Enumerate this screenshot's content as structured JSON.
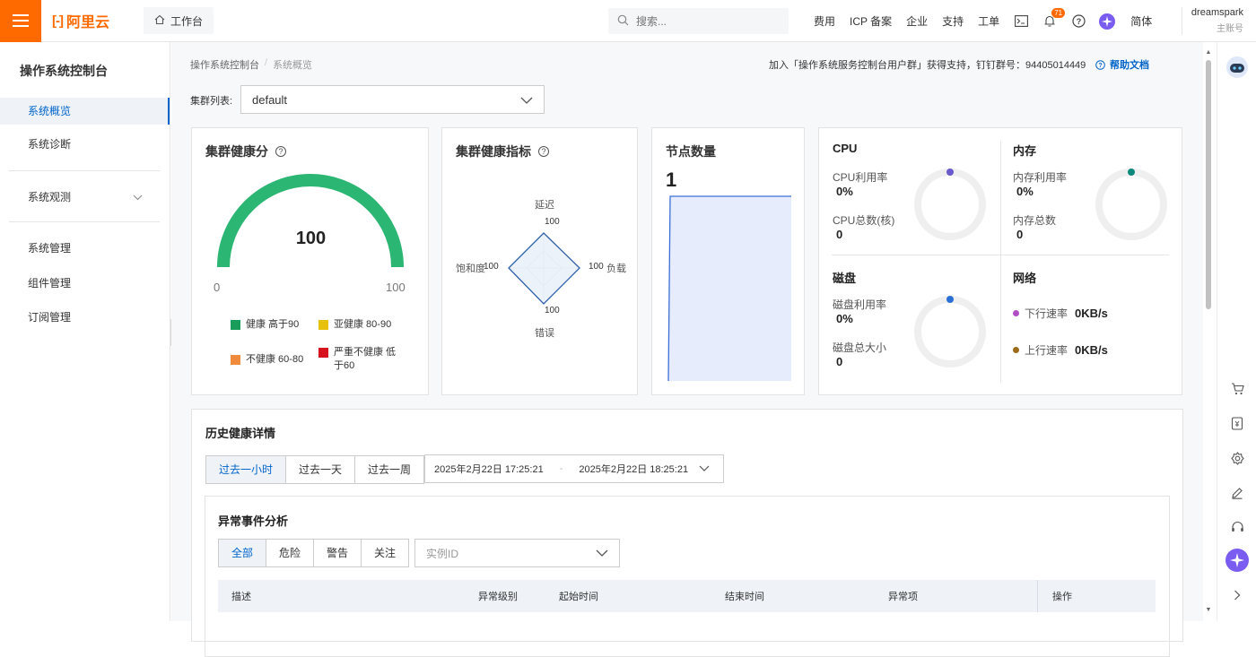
{
  "topbar": {
    "brand": "阿里云",
    "workbench": "工作台",
    "search_placeholder": "搜索...",
    "nav": [
      "费用",
      "ICP 备案",
      "企业",
      "支持",
      "工单"
    ],
    "notification_count": "71",
    "language": "简体",
    "account_name": "dreamspark",
    "account_role": "主账号"
  },
  "sidebar": {
    "title": "操作系统控制台",
    "items": [
      "系统概览",
      "系统诊断",
      "系统观测",
      "系统管理",
      "组件管理",
      "订阅管理"
    ]
  },
  "breadcrumb": [
    "操作系统控制台",
    "系统概览"
  ],
  "join_text": "加入「操作系统服务控制台用户群」获得支持，钉钉群号：94405014449",
  "help_text": "帮助文档",
  "cluster": {
    "label": "集群列表:",
    "value": "default"
  },
  "health_score": {
    "title": "集群健康分",
    "value": "100",
    "min": "0",
    "max": "100",
    "legend": [
      {
        "label": "健康 高于90",
        "color": "#1a9c5b"
      },
      {
        "label": "亚健康 80-90",
        "color": "#e8c10c"
      },
      {
        "label": "不健康 60-80",
        "color": "#f08a3c"
      },
      {
        "label": "严重不健康 低于60",
        "color": "#d7121f"
      }
    ],
    "gauge_color": "#2bb673",
    "gauge_fraction": 1.0
  },
  "health_metrics": {
    "title": "集群健康指标",
    "axes": {
      "top": "延迟",
      "right": "负载",
      "bottom": "错误",
      "left": "饱和度"
    },
    "values": {
      "top": "100",
      "right": "100",
      "bottom": "100",
      "left": "100"
    }
  },
  "nodes": {
    "title": "节点数量",
    "value": "1"
  },
  "resources": {
    "cpu": {
      "title": "CPU",
      "usage_label": "CPU利用率",
      "usage": "0%",
      "total_label": "CPU总数(核)",
      "total": "0",
      "dot_color": "#6a5acd"
    },
    "memory": {
      "title": "内存",
      "usage_label": "内存利用率",
      "usage": "0%",
      "total_label": "内存总数",
      "total": "0",
      "dot_color": "#0e8a7d"
    },
    "disk": {
      "title": "磁盘",
      "usage_label": "磁盘利用率",
      "usage": "0%",
      "total_label": "磁盘总大小",
      "total": "0",
      "dot_color": "#2a6fd6"
    },
    "network": {
      "title": "网络",
      "down_label": "下行速率",
      "down": "0KB/s",
      "down_color": "#b04fc4",
      "up_label": "上行速率",
      "up": "0KB/s",
      "up_color": "#9c6a1a"
    }
  },
  "history": {
    "title": "历史健康详情",
    "ranges": [
      "过去一小时",
      "过去一天",
      "过去一周"
    ],
    "start": "2025年2月22日 17:25:21",
    "sep": "-",
    "end": "2025年2月22日 18:25:21"
  },
  "anomaly": {
    "title": "异常事件分析",
    "filters": [
      "全部",
      "危险",
      "警告",
      "关注"
    ],
    "instance_placeholder": "实例ID",
    "columns": [
      "描述",
      "异常级别",
      "起始时间",
      "结束时间",
      "异常项",
      "操作"
    ]
  }
}
